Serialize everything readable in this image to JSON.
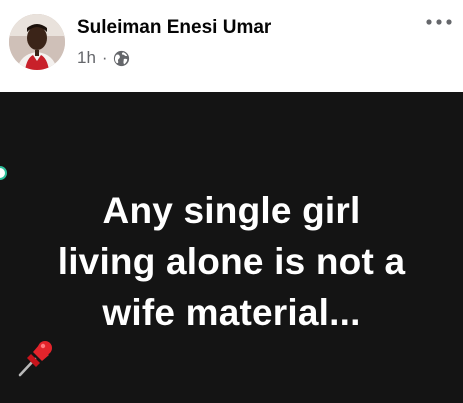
{
  "post": {
    "author": "Suleiman Enesi Umar",
    "time": "1h",
    "separator": "·",
    "privacy_icon": "globe-icon",
    "more_icon": "more-options-icon",
    "text_lines": [
      "Any single girl",
      "living alone is not a",
      "wife material..."
    ],
    "text_emoji": "pushpin-icon"
  },
  "colors": {
    "post_background": "#141414",
    "text": "#ffffff",
    "meta_text": "#65676b",
    "author_text": "#050505"
  }
}
